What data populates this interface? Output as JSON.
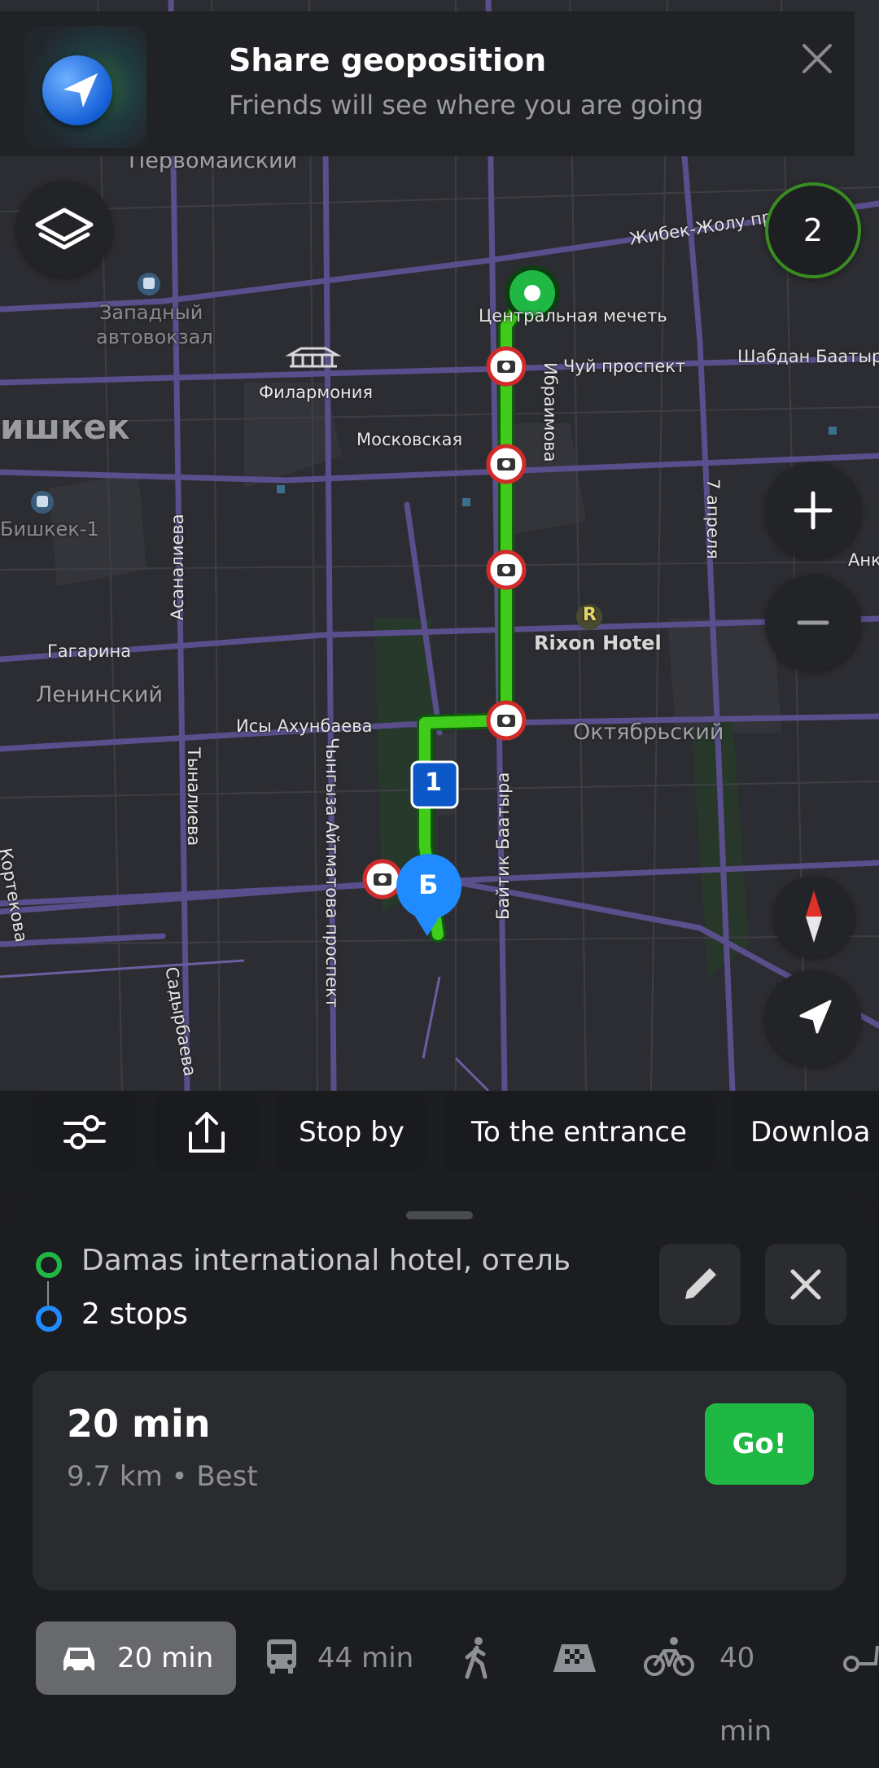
{
  "banner": {
    "title": "Share geoposition",
    "subtitle": "Friends will see where you are going"
  },
  "map": {
    "route_color": "#3fcc1a",
    "labels": {
      "pervomaisky": "Первомайский",
      "zhibek": "Жибек-Жолу проспект",
      "west_station": "Западный\nавтовокзал",
      "west_station_1": "Западный",
      "west_station_2": "автовокзал",
      "mosque": "Центральная мечеть",
      "chuy": "Чуй проспект",
      "shabdan": "Шабдан Баатыр",
      "philharmonia": "Филармония",
      "bishkek": "ишкек",
      "ibraimova": "Ибраимова",
      "moskovskaya": "Московская",
      "bishkek1": "Бишкек-1",
      "asanalieva": "Асаналиева",
      "april7": "7 апреля",
      "ank": "Анк",
      "rixon": "Rixon Hotel",
      "gagarina": "Гагарина",
      "leninsky": "Ленинский",
      "isy": "Исы Ахунбаева",
      "oktyabrsky": "Октябрьский",
      "tynalieva": "Тыналиева",
      "aitmatov": "Чынгыза Айтматова проспект",
      "baitik": "Байтик Баатыра",
      "sadyrbaeva": "Садырбаева",
      "kortekova": "Кортекова",
      "stop_number": "1",
      "destination_letter": "Б",
      "hotel_badge": "R"
    },
    "notifications_count": "2"
  },
  "chips": {
    "stop_by": "Stop by",
    "entrance": "To the entrance",
    "download": "Downloa"
  },
  "route": {
    "from": "Damas international hotel, отель",
    "stops": "2 stops",
    "time": "20 min",
    "meta": "9.7 km • Best",
    "go": "Go!"
  },
  "modes": {
    "car": "20 min",
    "bus": "44 min",
    "bike": "40 min"
  }
}
